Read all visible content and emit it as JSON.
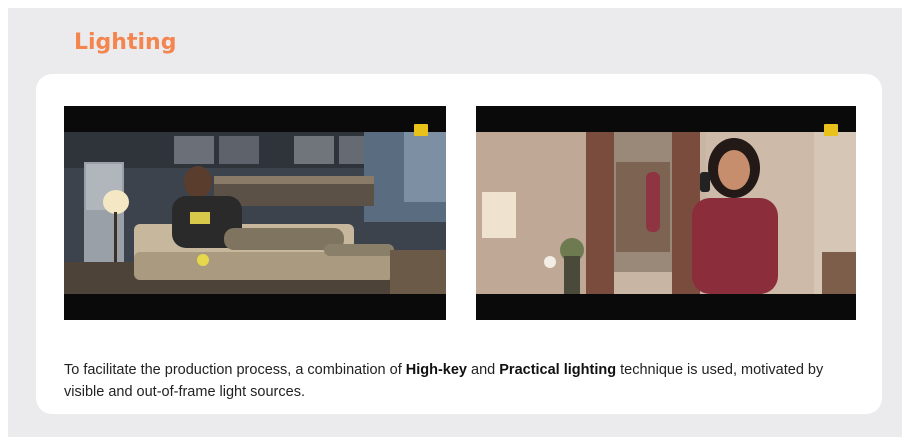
{
  "slide": {
    "title": "Lighting",
    "caption": {
      "part1": "To facilitate the production process, a combination of ",
      "bold1": "High-key",
      "part2": " and ",
      "bold2": "Practical lighting",
      "part3": " technique is used, motivated by visible and out-of-frame light sources."
    },
    "images": [
      {
        "icon": "film-still-man-on-sofa-phone"
      },
      {
        "icon": "film-still-woman-phone-mirror"
      }
    ]
  },
  "colors": {
    "accent": "#f4854f",
    "background": "#ebebed",
    "card": "#ffffff",
    "letterbox": "#0a0a0a",
    "badge": "#e8c21a"
  }
}
